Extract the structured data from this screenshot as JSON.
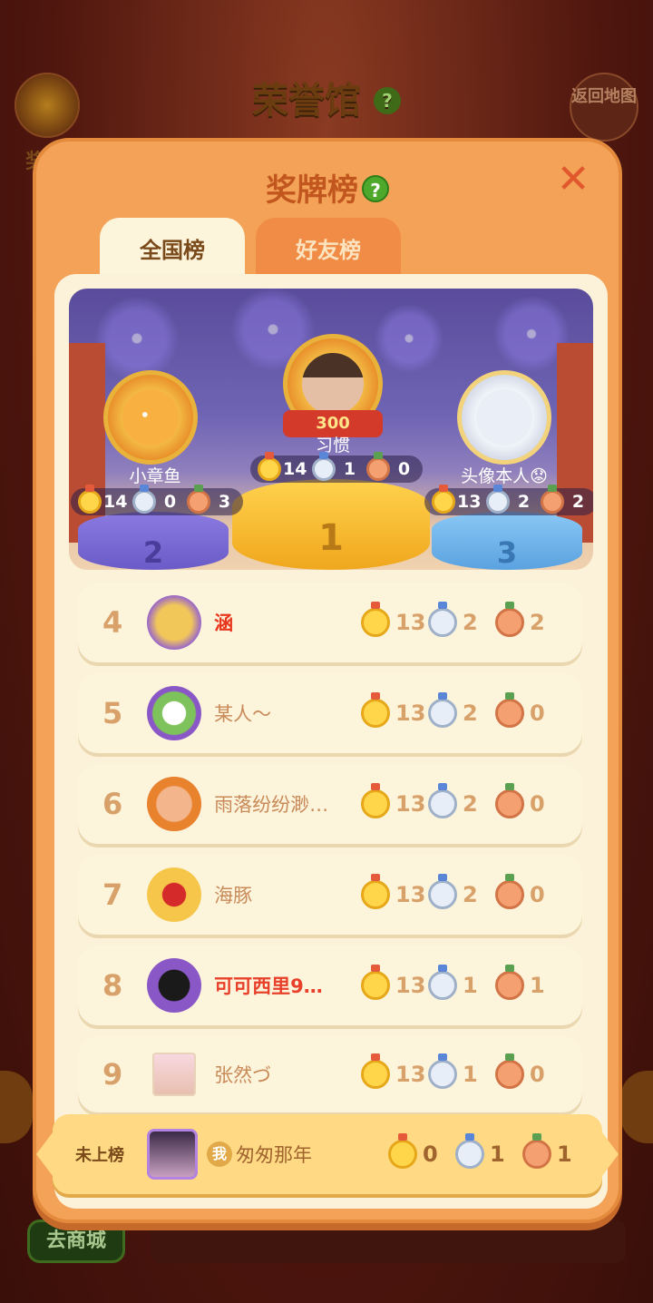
{
  "background": {
    "title": "荣誉馆",
    "left_label": "奖",
    "back_button": "返回地图",
    "shop_button": "去商城"
  },
  "modal": {
    "title": "奖牌榜",
    "tabs": [
      {
        "label": "全国榜",
        "active": true
      },
      {
        "label": "好友榜",
        "active": false
      }
    ]
  },
  "podium": {
    "first": {
      "rank": "1",
      "name": "习惯",
      "badge": "300",
      "gold": "14",
      "silver": "1",
      "bronze": "0"
    },
    "second": {
      "rank": "2",
      "name": "小章鱼",
      "gold": "14",
      "silver": "0",
      "bronze": "3"
    },
    "third": {
      "rank": "3",
      "name": "头像本人😟",
      "gold": "13",
      "silver": "2",
      "bronze": "2"
    }
  },
  "rows": [
    {
      "rank": "4",
      "name": "涵",
      "gold": "13",
      "silver": "2",
      "bronze": "2"
    },
    {
      "rank": "5",
      "name": "某人～",
      "gold": "13",
      "silver": "2",
      "bronze": "0"
    },
    {
      "rank": "6",
      "name": "雨落纷纷渺…",
      "gold": "13",
      "silver": "2",
      "bronze": "0"
    },
    {
      "rank": "7",
      "name": "海豚",
      "gold": "13",
      "silver": "2",
      "bronze": "0"
    },
    {
      "rank": "8",
      "name": "可可西里9…",
      "gold": "13",
      "silver": "1",
      "bronze": "1"
    },
    {
      "rank": "9",
      "name": "张然づ",
      "gold": "13",
      "silver": "1",
      "bronze": "0"
    }
  ],
  "me": {
    "rank_label": "未上榜",
    "tag": "我",
    "name": "匆匆那年",
    "gold": "0",
    "silver": "1",
    "bronze": "1"
  },
  "colors": {
    "modal": "#f3a257",
    "title": "#c2561f",
    "row_bg": "#fdf4dc",
    "accent_red": "#e8371d"
  }
}
